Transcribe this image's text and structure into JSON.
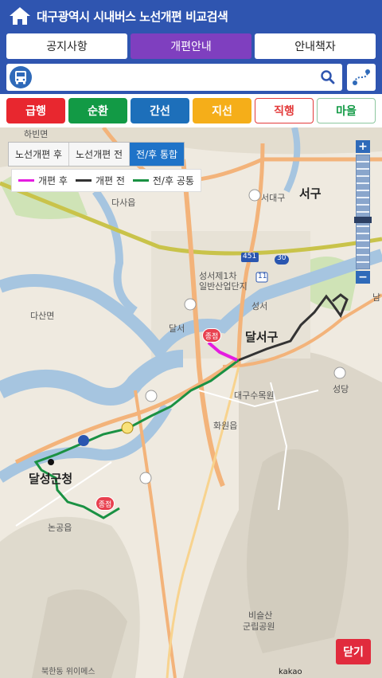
{
  "header": {
    "title": "대구광역시 시내버스 노선개편 비교검색"
  },
  "tabs": [
    {
      "label": "공지사항",
      "active": false
    },
    {
      "label": "개편안내",
      "active": true
    },
    {
      "label": "안내책자",
      "active": false
    }
  ],
  "search": {
    "value": "",
    "placeholder": ""
  },
  "route_types": [
    {
      "label": "급행",
      "bg": "#e8272f",
      "color": "#ffffff",
      "border": "#e8272f"
    },
    {
      "label": "순환",
      "bg": "#129a45",
      "color": "#ffffff",
      "border": "#129a45"
    },
    {
      "label": "간선",
      "bg": "#1d6fba",
      "color": "#ffffff",
      "border": "#1d6fba"
    },
    {
      "label": "지선",
      "bg": "#f5ae19",
      "color": "#ffffff",
      "border": "#f5ae19"
    },
    {
      "label": "직행",
      "bg": "#ffffff",
      "color": "#e33a3a",
      "border": "#e33a3a"
    },
    {
      "label": "마을",
      "bg": "#ffffff",
      "color": "#129a45",
      "border": "#8dc79f"
    }
  ],
  "map": {
    "view_tabs": [
      {
        "label": "노선개편 후",
        "active": false
      },
      {
        "label": "노선개편 전",
        "active": false
      },
      {
        "label": "전/후 통합",
        "active": true
      }
    ],
    "legend": [
      {
        "label": "개편 후",
        "color": "#e51ce0"
      },
      {
        "label": "개편 전",
        "color": "#333333"
      },
      {
        "label": "전/후 공통",
        "color": "#1a9143"
      }
    ],
    "labels": {
      "dalseong": "달성군청",
      "dalseo": "달서구",
      "seogu": "서구",
      "seodaegu": "서대구",
      "dasa": "다사읍",
      "dasan": "다산면",
      "hwawon": "화원읍",
      "nongong": "논공읍",
      "bisulsan": "비슬산",
      "bisulsan2": "군립공원",
      "seongseo": "성서",
      "dalseo_road": "달서",
      "hayang": "하빈면",
      "industrial": "성서제1차",
      "industrial2": "일반산업단지",
      "daegu_univ": "대구수목원",
      "seongdang": "성당",
      "nam": "남",
      "road_451": "451",
      "road_30": "30",
      "road_11": "11"
    },
    "stop_badge": "종점",
    "zoom_in": "+",
    "zoom_out": "−",
    "close_label": "닫기",
    "attribution": "북한동 위이메스",
    "provider": "kakao"
  }
}
